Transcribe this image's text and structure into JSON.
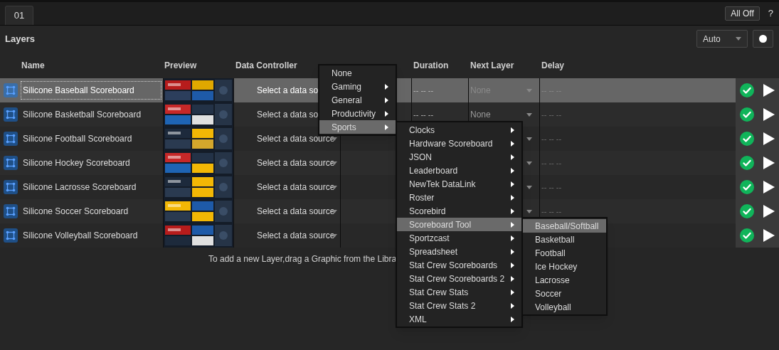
{
  "tabs": [
    {
      "label": "01",
      "selected": true
    }
  ],
  "all_off_button": "All Off",
  "help_button": "?",
  "panel": {
    "title": "Layers",
    "mode_select": "Auto",
    "record_on": true
  },
  "table": {
    "columns": [
      "Name",
      "Preview",
      "Data Controller",
      "Duration",
      "Next Layer",
      "Delay"
    ],
    "rows": [
      {
        "name": "Silicone Baseball Scoreboard",
        "selected": true,
        "data_controller": "Select a data so",
        "data_arrow": false,
        "duration": "-- -- --",
        "next_layer": "None",
        "next_arrow": true,
        "delay": "-- -- --",
        "ready": true
      },
      {
        "name": "Silicone Basketball Scoreboard",
        "selected": false,
        "data_controller": "Select a data so",
        "data_arrow": false,
        "duration": "-- -- --",
        "next_layer": "None",
        "next_arrow": true,
        "delay": "-- -- --",
        "ready": true
      },
      {
        "name": "Silicone Football Scoreboard",
        "selected": false,
        "data_controller": "Select a data source",
        "data_arrow": true,
        "next_arrow": true,
        "delay": "-- -- --",
        "ready": true
      },
      {
        "name": "Silicone Hockey Scoreboard",
        "selected": false,
        "data_controller": "Select a data source",
        "data_arrow": true,
        "next_arrow": true,
        "delay": "-- -- --",
        "ready": true
      },
      {
        "name": "Silicone Lacrosse Scoreboard",
        "selected": false,
        "data_controller": "Select a data source",
        "data_arrow": true,
        "next_arrow": true,
        "delay": "-- -- --",
        "ready": true
      },
      {
        "name": "Silicone Soccer Scoreboard",
        "selected": false,
        "data_controller": "Select a data source",
        "data_arrow": true,
        "next_arrow": true,
        "delay": "-- -- --",
        "ready": true
      },
      {
        "name": "Silicone Volleyball Scoreboard",
        "selected": false,
        "data_controller": "Select a data source",
        "data_arrow": true,
        "next_arrow": false,
        "ready": true
      }
    ]
  },
  "hint": "To add a new Layer,drag a Graphic from the Libra",
  "menus": [
    {
      "items": [
        {
          "label": "None",
          "has_submenu": false,
          "selected": false
        },
        {
          "label": "Gaming",
          "has_submenu": true,
          "selected": false
        },
        {
          "label": "General",
          "has_submenu": true,
          "selected": false
        },
        {
          "label": "Productivity",
          "has_submenu": true,
          "selected": false
        },
        {
          "label": "Sports",
          "has_submenu": true,
          "selected": true
        }
      ]
    },
    {
      "items": [
        {
          "label": "Clocks",
          "has_submenu": true,
          "selected": false
        },
        {
          "label": "Hardware Scoreboard",
          "has_submenu": true,
          "selected": false
        },
        {
          "label": "JSON",
          "has_submenu": true,
          "selected": false
        },
        {
          "label": "Leaderboard",
          "has_submenu": true,
          "selected": false
        },
        {
          "label": "NewTek DataLink",
          "has_submenu": true,
          "selected": false
        },
        {
          "label": "Roster",
          "has_submenu": true,
          "selected": false
        },
        {
          "label": "Scorebird",
          "has_submenu": true,
          "selected": false
        },
        {
          "label": "Scoreboard Tool",
          "has_submenu": true,
          "selected": true
        },
        {
          "label": "Sportzcast",
          "has_submenu": true,
          "selected": false
        },
        {
          "label": "Spreadsheet",
          "has_submenu": true,
          "selected": false
        },
        {
          "label": "Stat Crew Scoreboards",
          "has_submenu": true,
          "selected": false
        },
        {
          "label": "Stat Crew Scoreboards 2",
          "has_submenu": true,
          "selected": false
        },
        {
          "label": "Stat Crew Stats",
          "has_submenu": true,
          "selected": false
        },
        {
          "label": "Stat Crew Stats 2",
          "has_submenu": true,
          "selected": false
        },
        {
          "label": "XML",
          "has_submenu": true,
          "selected": false
        }
      ]
    },
    {
      "items": [
        {
          "label": "Baseball/Softball",
          "has_submenu": false,
          "selected": true
        },
        {
          "label": "Basketball",
          "has_submenu": false,
          "selected": false
        },
        {
          "label": "Football",
          "has_submenu": false,
          "selected": false
        },
        {
          "label": "Ice Hockey",
          "has_submenu": false,
          "selected": false
        },
        {
          "label": "Lacrosse",
          "has_submenu": false,
          "selected": false
        },
        {
          "label": "Soccer",
          "has_submenu": false,
          "selected": false
        },
        {
          "label": "Volleyball",
          "has_submenu": false,
          "selected": false
        }
      ]
    }
  ]
}
